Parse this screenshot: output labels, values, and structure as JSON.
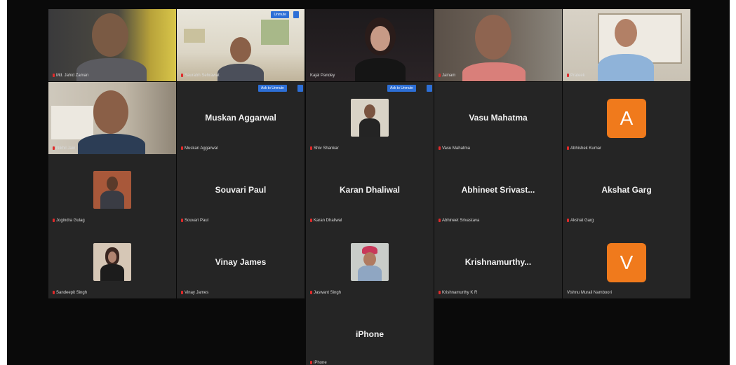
{
  "participants": [
    {
      "id": "p1",
      "label": "Md. Jahid Zaman",
      "kind": "video"
    },
    {
      "id": "p2",
      "label": "Saurabh Sehrawat",
      "kind": "video",
      "badge": "Unmute"
    },
    {
      "id": "p3",
      "label": "Kajal Pandey",
      "kind": "video",
      "active": true
    },
    {
      "id": "p4",
      "label": "Jainam",
      "kind": "video"
    },
    {
      "id": "p5",
      "label": "Prateek",
      "kind": "video"
    },
    {
      "id": "p6",
      "label": "Nikhil Jain",
      "kind": "video"
    },
    {
      "id": "p7",
      "label": "Muskan Aggarwal",
      "kind": "name",
      "display": "Muskan Aggarwal",
      "badge": "Ask to Unmute"
    },
    {
      "id": "p8",
      "label": "Shiv Shankar",
      "kind": "photo",
      "badge": "Ask to Unmute"
    },
    {
      "id": "p9",
      "label": "Vasu Mahatma",
      "kind": "name",
      "display": "Vasu Mahatma"
    },
    {
      "id": "p10",
      "label": "Abhishek Kumar",
      "kind": "letter",
      "letter": "A"
    },
    {
      "id": "p11",
      "label": "Jogindra Gulag",
      "kind": "photo"
    },
    {
      "id": "p12",
      "label": "Souvari Paul",
      "kind": "name",
      "display": "Souvari Paul"
    },
    {
      "id": "p13",
      "label": "Karan Dhaliwal",
      "kind": "name",
      "display": "Karan Dhaliwal"
    },
    {
      "id": "p14",
      "label": "Abhineet Srivastava",
      "kind": "name",
      "display": "Abhineet  Srivast..."
    },
    {
      "id": "p15",
      "label": "Akshat Garg",
      "kind": "name",
      "display": "Akshat Garg"
    },
    {
      "id": "p16",
      "label": "Sandeepit Singh",
      "kind": "photo"
    },
    {
      "id": "p17",
      "label": "Vinay James",
      "kind": "name",
      "display": "Vinay James"
    },
    {
      "id": "p18",
      "label": "Jaswant Singh",
      "kind": "photo"
    },
    {
      "id": "p19",
      "label": "Krishnamurthy K R",
      "kind": "name",
      "display": "Krishnamurthy..."
    },
    {
      "id": "p20",
      "label": "Vishnu Murali Namboori",
      "kind": "letter",
      "letter": "V"
    },
    {
      "id": "p21",
      "label": "iPhone",
      "kind": "name",
      "display": "iPhone"
    }
  ],
  "colors": {
    "tile_bg": "#252525",
    "screen_bg": "#0a0a0a",
    "active_speaker": "#2e9f4f",
    "avatar_orange": "#f07a1c",
    "muted_red": "#e02b2b",
    "badge_blue": "#2d6fd6"
  }
}
